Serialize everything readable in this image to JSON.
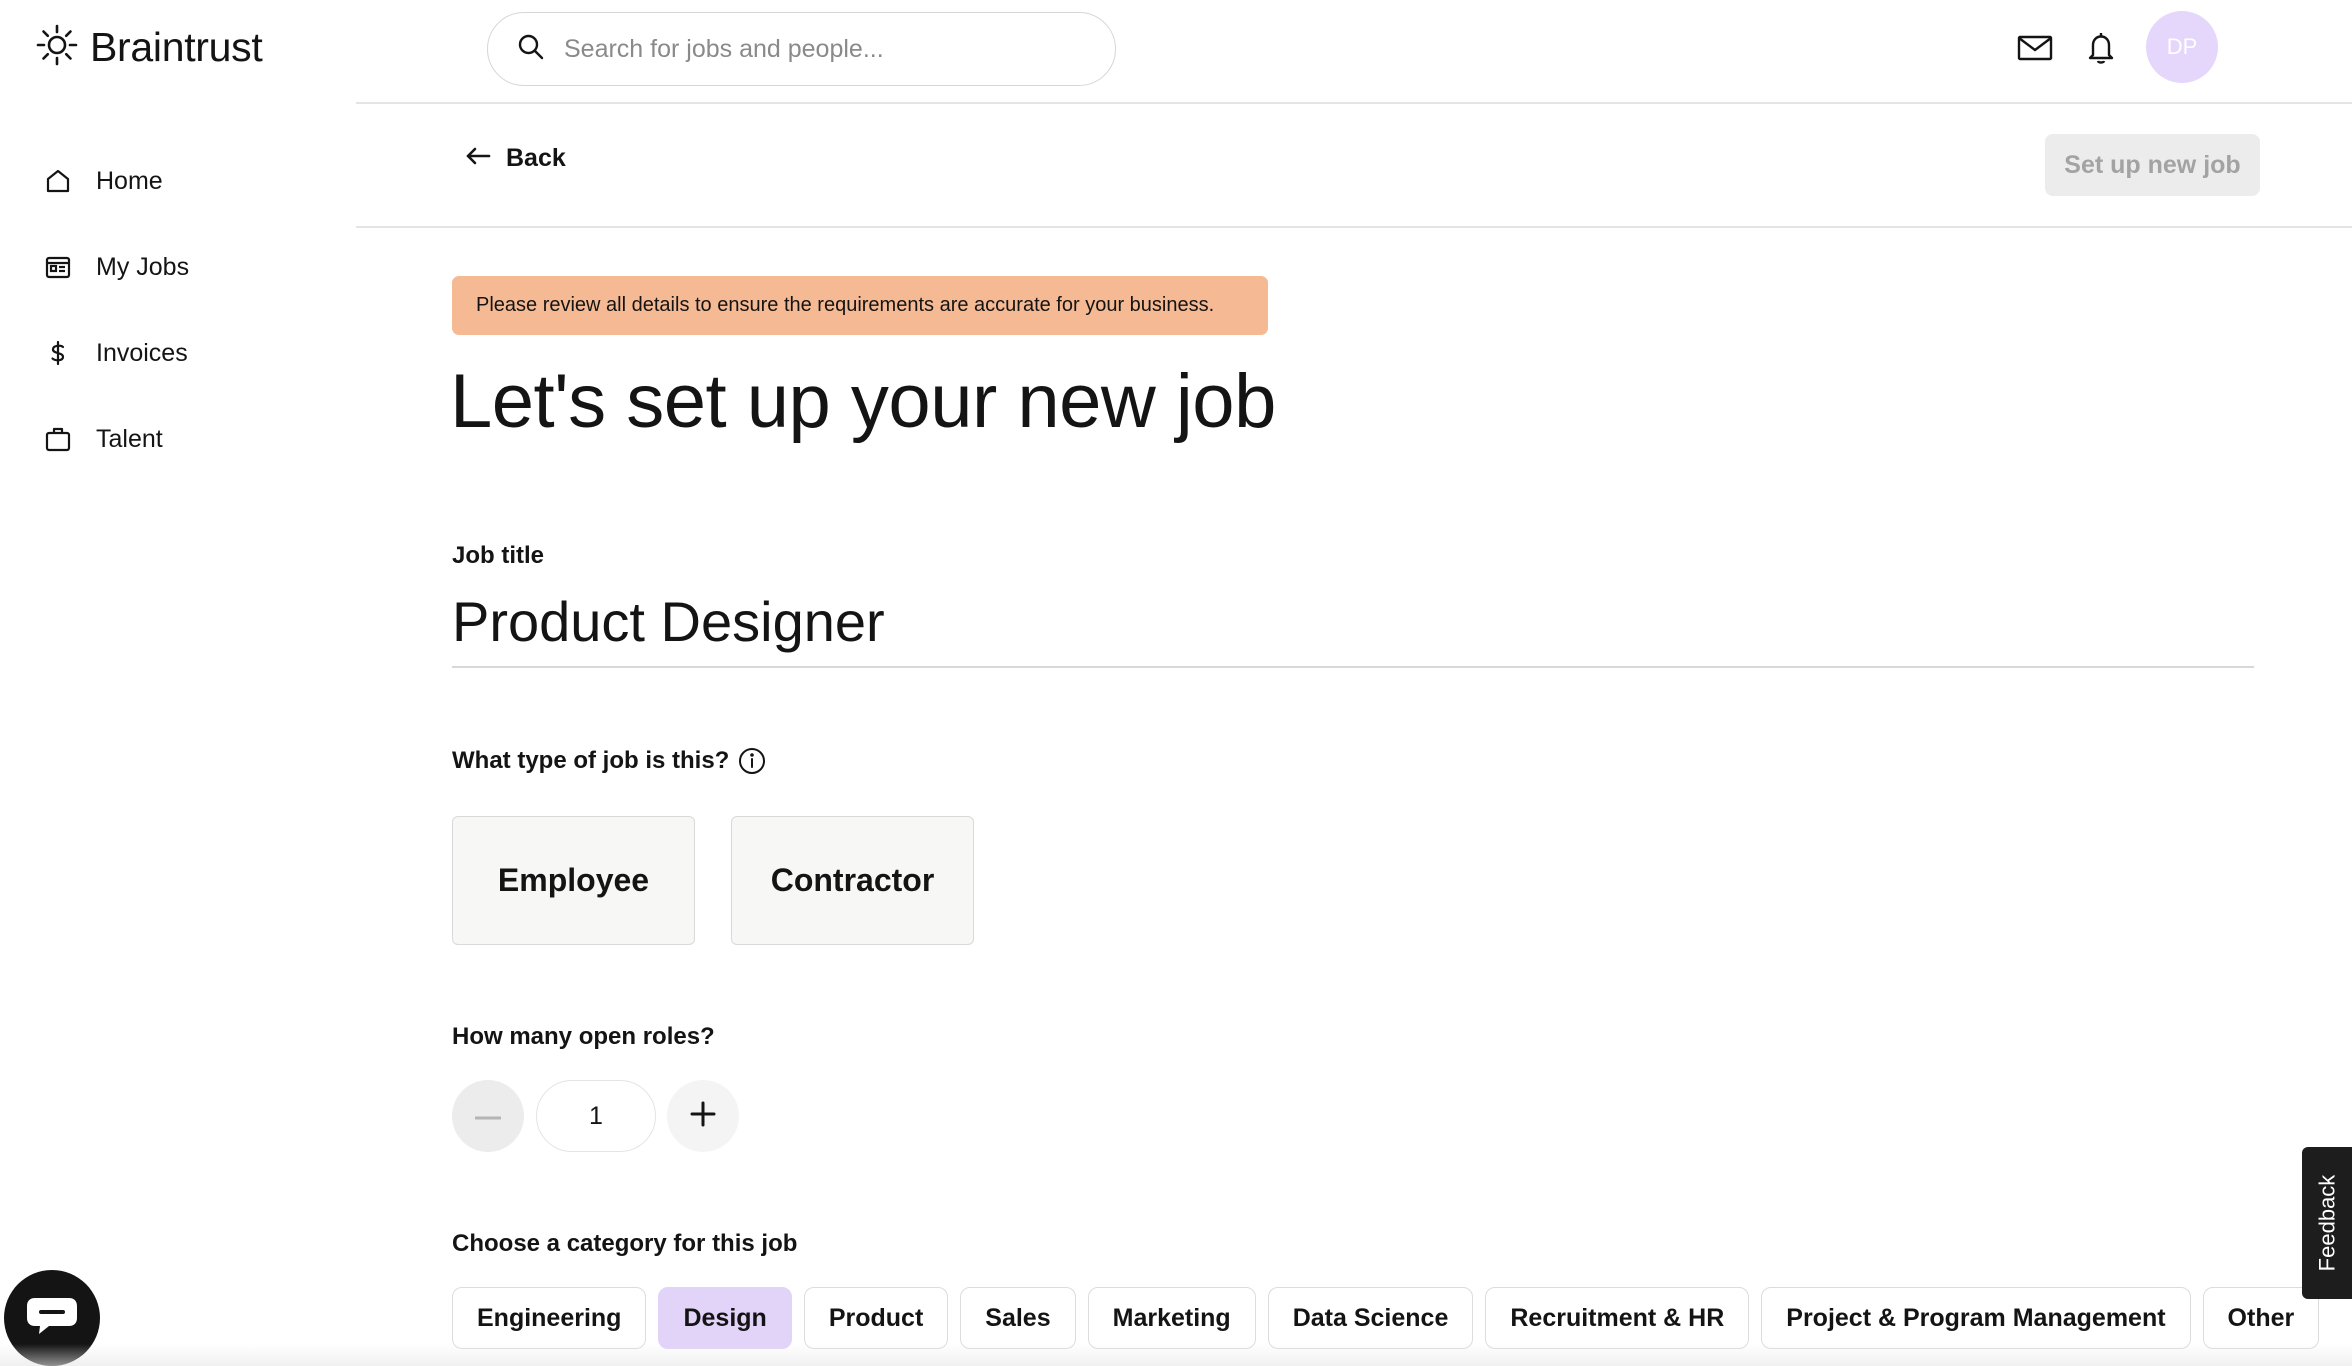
{
  "app": {
    "name": "Braintrust"
  },
  "sidebar": {
    "items": [
      {
        "label": "Home",
        "icon": "home-icon"
      },
      {
        "label": "My Jobs",
        "icon": "jobs-icon"
      },
      {
        "label": "Invoices",
        "icon": "dollar-icon"
      },
      {
        "label": "Talent",
        "icon": "briefcase-icon"
      }
    ]
  },
  "topbar": {
    "search_placeholder": "Search for jobs and people...",
    "search_value": "",
    "avatar_initials": "DP"
  },
  "actionbar": {
    "back_label": "Back",
    "setup_button_label": "Set up new job"
  },
  "banner": {
    "text": "Please review all details to ensure the requirements are accurate for your business."
  },
  "page": {
    "title": "Let's set up your new job"
  },
  "form": {
    "job_title_label": "Job title",
    "job_title_value": "Product Designer",
    "job_type_label": "What type of job is this?",
    "job_types": [
      "Employee",
      "Contractor"
    ],
    "open_roles_label": "How many open roles?",
    "open_roles_value": "1",
    "category_label": "Choose a category for this job",
    "categories": [
      "Engineering",
      "Design",
      "Product",
      "Sales",
      "Marketing",
      "Data Science",
      "Recruitment & HR",
      "Project & Program Management",
      "Other"
    ],
    "selected_category": "Design"
  },
  "feedback": {
    "label": "Feedback"
  },
  "colors": {
    "banner_bg": "#f5ba93",
    "selected_pill_bg": "#e2d3f9",
    "avatar_bg": "#e5d6fb",
    "disabled_button_bg": "#ececec"
  }
}
